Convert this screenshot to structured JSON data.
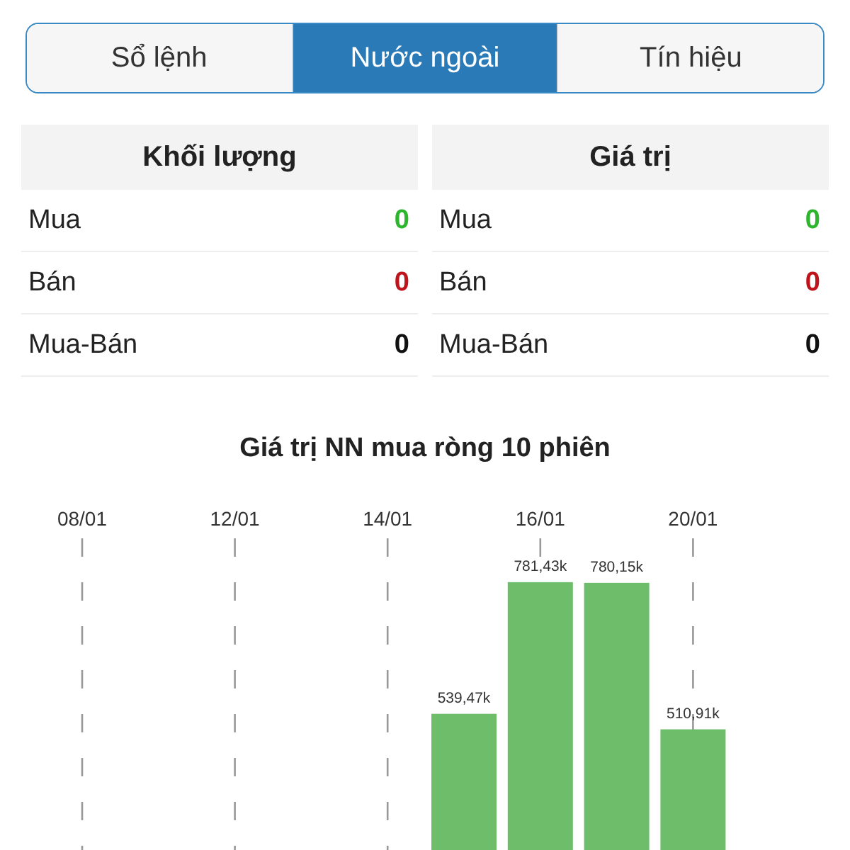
{
  "tabs": [
    {
      "label": "Sổ lệnh",
      "selected": false
    },
    {
      "label": "Nước ngoài",
      "selected": true
    },
    {
      "label": "Tín hiệu",
      "selected": false
    }
  ],
  "panels": [
    {
      "title": "Khối lượng",
      "rows": [
        {
          "label": "Mua",
          "value": "0",
          "kind": "buy"
        },
        {
          "label": "Bán",
          "value": "0",
          "kind": "sell"
        },
        {
          "label": "Mua-Bán",
          "value": "0",
          "kind": "net"
        }
      ]
    },
    {
      "title": "Giá trị",
      "rows": [
        {
          "label": "Mua",
          "value": "0",
          "kind": "buy"
        },
        {
          "label": "Bán",
          "value": "0",
          "kind": "sell"
        },
        {
          "label": "Mua-Bán",
          "value": "0",
          "kind": "net"
        }
      ]
    }
  ],
  "chart": {
    "chart_data": {
      "type": "bar",
      "title": "Giá trị NN mua ròng 10 phiên",
      "categories": [
        "08/01",
        null,
        "12/01",
        null,
        "14/01",
        null,
        "16/01",
        null,
        "20/01",
        null
      ],
      "series": [
        {
          "color": "#6dbd6b",
          "values": [
            null,
            null,
            null,
            null,
            null,
            539.47,
            781.43,
            780.15,
            510.91,
            null
          ],
          "value_labels": [
            null,
            null,
            null,
            null,
            null,
            "539,47k",
            "781,43k",
            "780,15k",
            "510,91k",
            null
          ]
        }
      ],
      "grid": "x"
    }
  }
}
